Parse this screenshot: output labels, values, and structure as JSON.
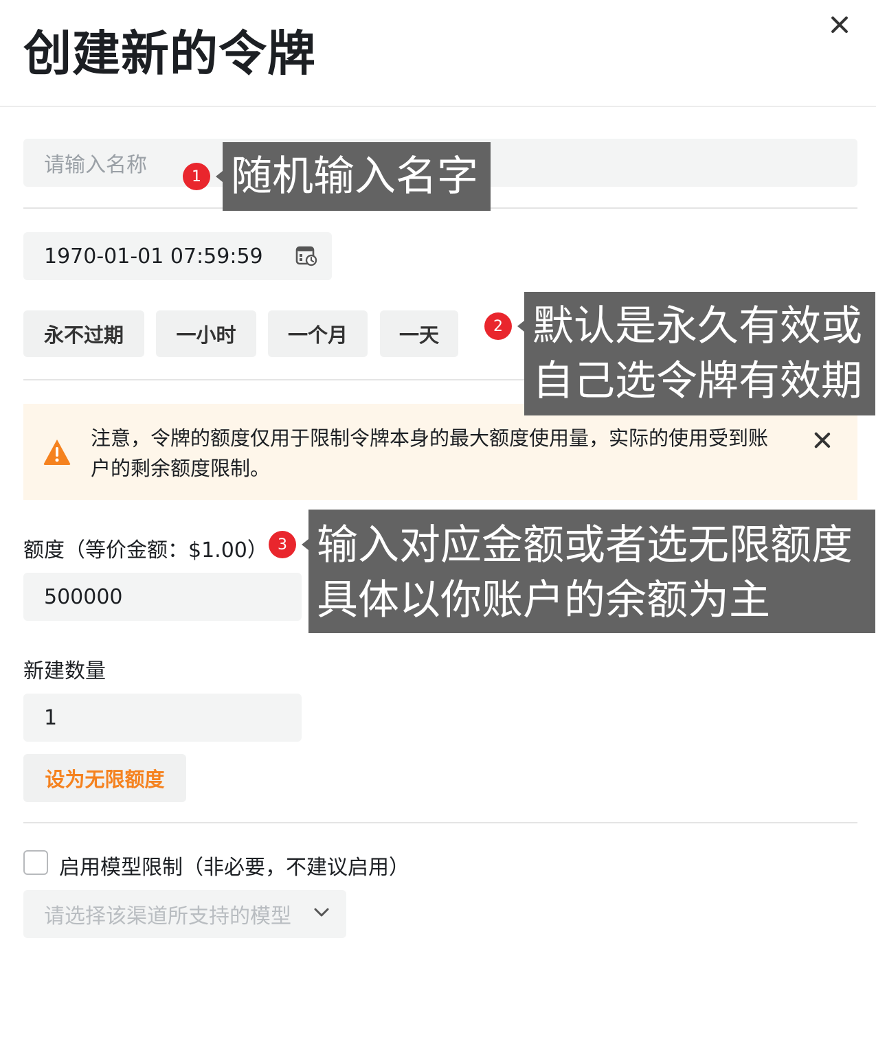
{
  "dialog": {
    "title": "创建新的令牌"
  },
  "name_field": {
    "placeholder": "请输入名称"
  },
  "expiry_field": {
    "value": "1970-01-01 07:59:59"
  },
  "quick_expiry": [
    "永不过期",
    "一小时",
    "一个月",
    "一天"
  ],
  "warning": {
    "text": "注意，令牌的额度仅用于限制令牌本身的最大额度使用量，实际的使用受到账户的剩余额度限制。"
  },
  "quota": {
    "label": "额度（等价金额：$1.00）",
    "value": "500000"
  },
  "count": {
    "label": "新建数量",
    "value": "1"
  },
  "unlimited_button": "设为无限额度",
  "model_limit": {
    "checkbox_label": "启用模型限制（非必要，不建议启用）",
    "select_placeholder": "请选择该渠道所支持的模型"
  },
  "annotations": [
    {
      "badge": "1",
      "lines": [
        "随机输入名字"
      ]
    },
    {
      "badge": "2",
      "lines": [
        "默认是永久有效或",
        "自己选令牌有效期"
      ]
    },
    {
      "badge": "3",
      "lines": [
        "输入对应金额或者选无限额度",
        "具体以你账户的余额为主"
      ]
    }
  ],
  "colors": {
    "accent_orange": "#f5821f",
    "badge_red": "#e9262d",
    "callout_bg": "#636363",
    "warning_bg": "#fef6ea"
  }
}
